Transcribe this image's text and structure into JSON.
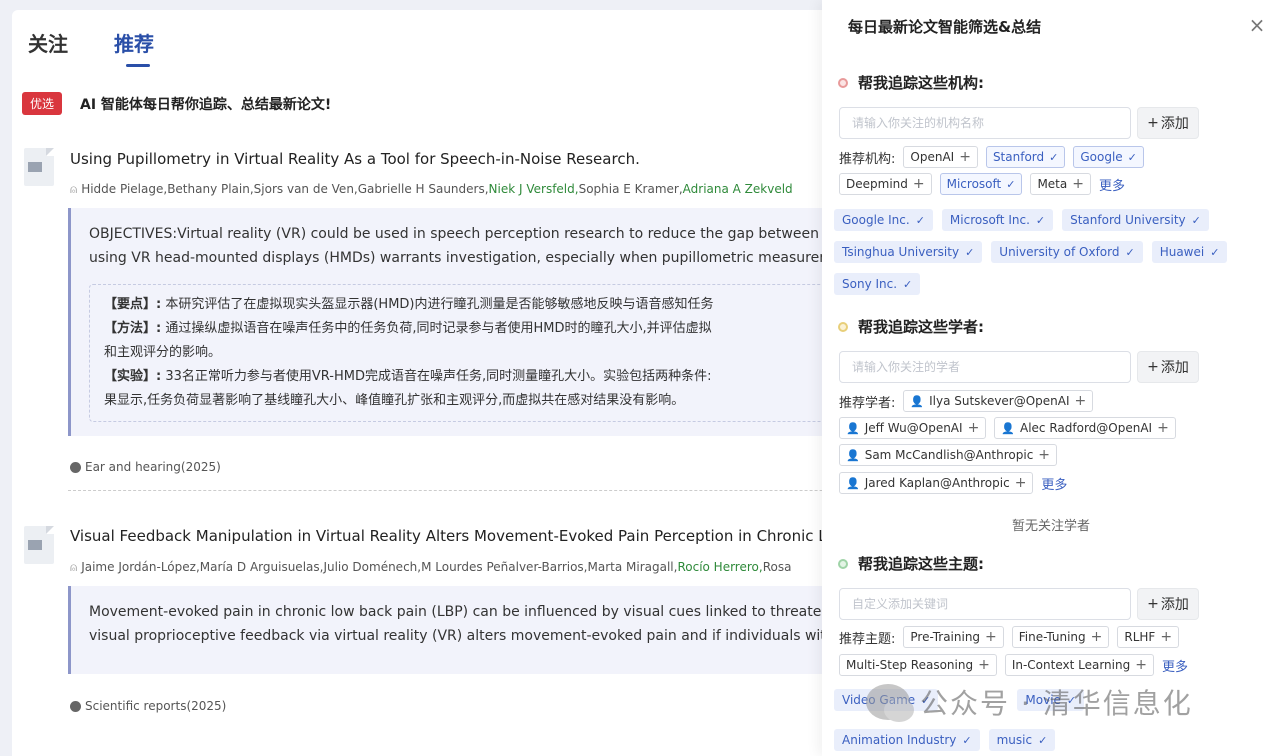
{
  "tabs": [
    {
      "label": "关注"
    },
    {
      "label": "推荐"
    }
  ],
  "promo": {
    "badge": "优选",
    "text": "AI 智能体每日帮你追踪、总结最新论文!"
  },
  "papers": [
    {
      "title": "Using Pupillometry in Virtual Reality As a Tool for Speech-in-Noise Research.",
      "authors": [
        {
          "name": "Hidde Pielage, ",
          "highlight": false
        },
        {
          "name": "Bethany Plain, ",
          "highlight": false
        },
        {
          "name": "Sjors van de Ven, ",
          "highlight": false
        },
        {
          "name": "Gabrielle H Saunders, ",
          "highlight": false
        },
        {
          "name": "Niek J Versfeld, ",
          "highlight": true
        },
        {
          "name": "Sophia E Kramer, ",
          "highlight": false
        },
        {
          "name": "Adriana A Zekveld",
          "highlight": true
        }
      ],
      "abstract_lines": [
        "OBJECTIVES:Virtual reality (VR) could be used in speech perception research to reduce the gap between the",
        "using VR head-mounted displays (HMDs) warrants investigation, especially when pupillometric measuremen"
      ],
      "summary": {
        "l1_key": "【要点】:",
        "l1_text": "本研究评估了在虚拟现实头盔显示器(HMD)内进行瞳孔测量是否能够敏感地反映与语音感知任务",
        "l2_key": "【方法】:",
        "l2_text": "通过操纵虚拟语音在噪声任务中的任务负荷,同时记录参与者使用HMD时的瞳孔大小,并评估虚拟",
        "l3_text": "和主观评分的影响。",
        "l4_key": "【实验】:",
        "l4_text": "33名正常听力参与者使用VR-HMD完成语音在噪声任务,同时测量瞳孔大小。实验包括两种条件:",
        "l5_text": "果显示,任务负荷显著影响了基线瞳孔大小、峰值瞳孔扩张和主观评分,而虚拟共在感对结果没有影响。"
      },
      "journal": "Ear and hearing(2025)"
    },
    {
      "title": "Visual Feedback Manipulation in Virtual Reality Alters Movement-Evoked Pain Perception in Chronic Lo",
      "authors": [
        {
          "name": "Jaime Jordán-López, ",
          "highlight": false
        },
        {
          "name": "María D Arguisuelas, ",
          "highlight": false
        },
        {
          "name": "Julio Doménech, ",
          "highlight": false
        },
        {
          "name": "M Lourdes Peñalver-Barrios, ",
          "highlight": false
        },
        {
          "name": "Marta Miragall, ",
          "highlight": false
        },
        {
          "name": "Rocío Herrero, ",
          "highlight": true
        },
        {
          "name": "Rosa",
          "highlight": false
        }
      ],
      "abstract_lines": [
        "Movement-evoked pain in chronic low back pain (LBP) can be influenced by visual cues linked to threatening",
        "visual proprioceptive feedback via virtual reality (VR) alters movement-evoked pain and if individuals with hig"
      ],
      "journal": "Scientific reports(2025)"
    }
  ],
  "panel": {
    "title": "每日最新论文智能筛选&总结",
    "close": "×",
    "add_label": "添加",
    "institutions": {
      "heading": "帮我追踪这些机构:",
      "placeholder": "请输入你关注的机构名称",
      "rec_label": "推荐机构:",
      "row1": [
        {
          "label": "OpenAI",
          "selected": false
        },
        {
          "label": "Stanford",
          "selected": true
        },
        {
          "label": "Google",
          "selected": true
        }
      ],
      "row2": [
        {
          "label": "Deepmind",
          "selected": false
        },
        {
          "label": "Microsoft",
          "selected": true
        },
        {
          "label": "Meta",
          "selected": false
        }
      ],
      "more": "更多",
      "selected": [
        "Google Inc.",
        "Microsoft Inc.",
        "Stanford University",
        "Tsinghua University",
        "University of Oxford",
        "Huawei",
        "Sony Inc."
      ]
    },
    "scholars": {
      "heading": "帮我追踪这些学者:",
      "placeholder": "请输入你关注的学者",
      "rec_label": "推荐学者:",
      "chips": [
        "Ilya Sutskever@OpenAI",
        "Jeff Wu@OpenAI",
        "Alec Radford@OpenAI",
        "Sam McCandlish@Anthropic",
        "Jared Kaplan@Anthropic"
      ],
      "more": "更多",
      "empty": "暂无关注学者"
    },
    "topics": {
      "heading": "帮我追踪这些主题:",
      "placeholder": "自定义添加关键词",
      "rec_label": "推荐主题:",
      "row1": [
        "Pre-Training",
        "Fine-Tuning",
        "RLHF"
      ],
      "row2": [
        "Multi-Step Reasoning",
        "In-Context Learning"
      ],
      "more": "更多",
      "selected_row1": [
        "Video Game",
        "",
        "Movie"
      ],
      "selected_row2": [
        "Animation Industry",
        "music"
      ]
    }
  },
  "watermark": "公众号 · 清华信息化",
  "colors": {
    "accent": "#3a5fc0",
    "tab_active": "#2a4fa8",
    "badge": "#d9363e",
    "author_highlight": "#2f8a3a"
  }
}
